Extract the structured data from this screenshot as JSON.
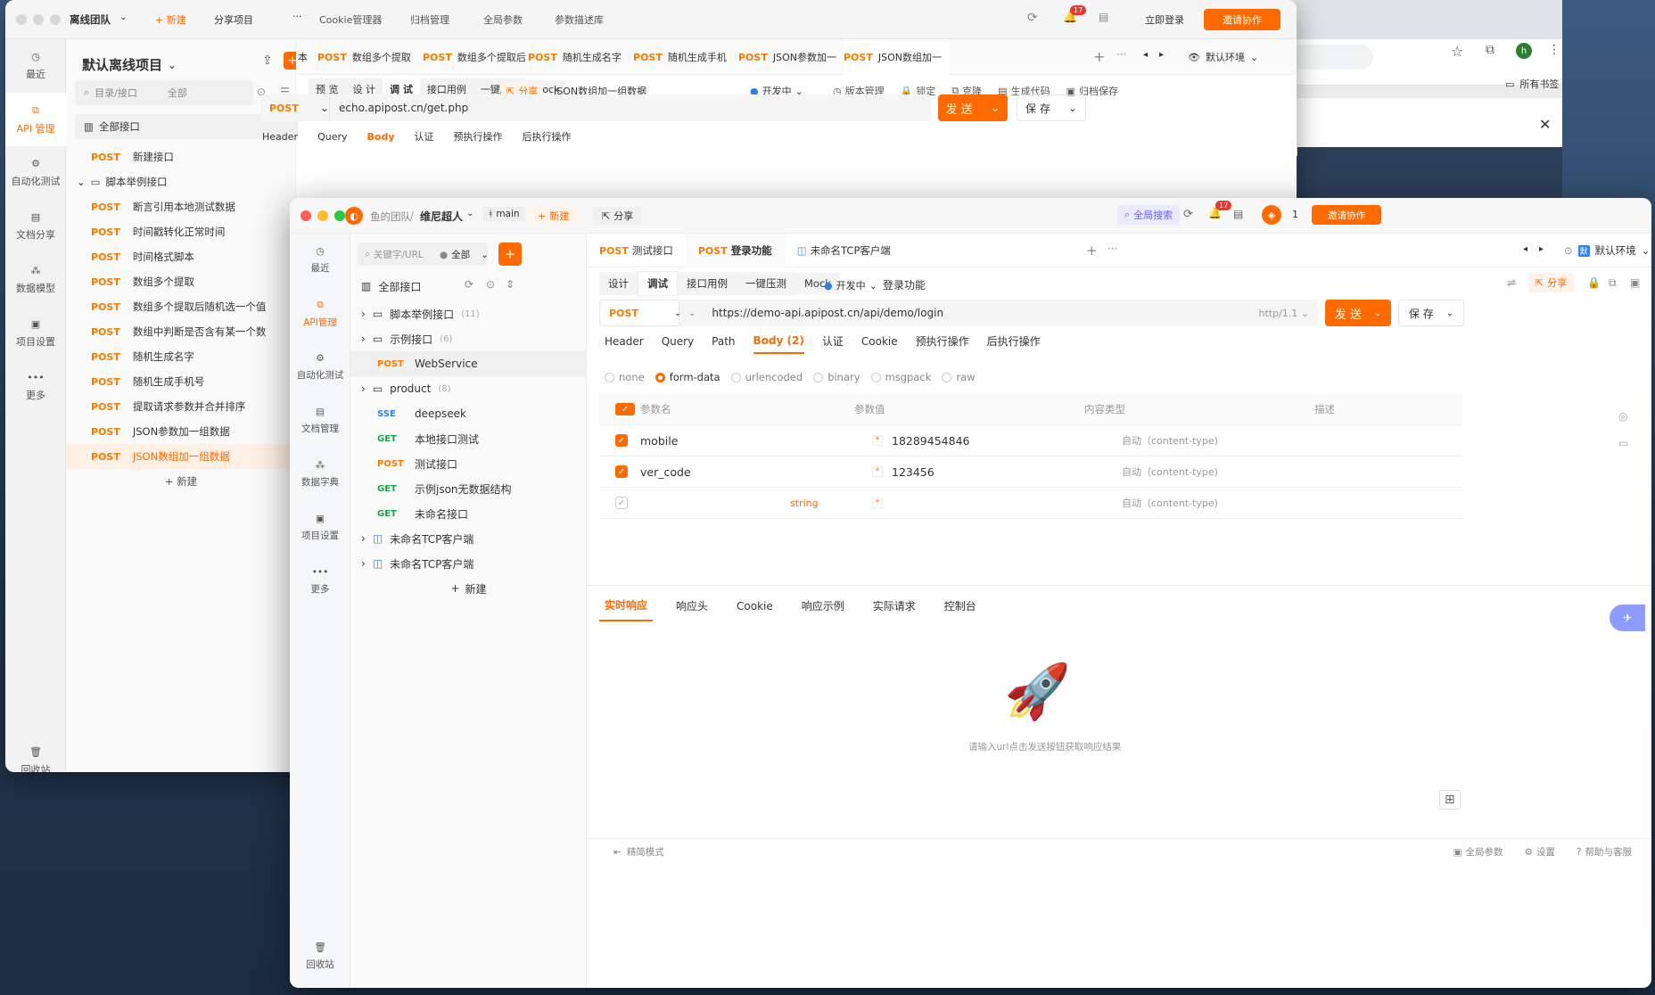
{
  "back": {
    "team": "离线团队",
    "top": [
      "+ 新建",
      "分享项目",
      "···",
      "Cookie管理器",
      "归档管理",
      "全局参数",
      "参数描述库"
    ],
    "badge": "17",
    "login": "立即登录",
    "invite": "邀请协作",
    "sidebar": [
      "最近",
      "API 管理",
      "自动化测试",
      "文档分享",
      "数据模型",
      "项目设置",
      "更多",
      "回收站"
    ],
    "project": "默认离线项目",
    "search_placeholder": "目录/接口",
    "filter_all": "全部",
    "all_apis": "全部接口",
    "folder": "脚本举例接口",
    "new_api_method": "POST",
    "new_api": "新建接口",
    "items": [
      {
        "m": "POST",
        "n": "断言引用本地测试数据"
      },
      {
        "m": "POST",
        "n": "时间戳转化正常时间"
      },
      {
        "m": "POST",
        "n": "时间格式脚本"
      },
      {
        "m": "POST",
        "n": "数组多个提取"
      },
      {
        "m": "POST",
        "n": "数组多个提取后随机选一个值"
      },
      {
        "m": "POST",
        "n": "数组中判断是否含有某一个数"
      },
      {
        "m": "POST",
        "n": "随机生成名字"
      },
      {
        "m": "POST",
        "n": "随机生成手机号"
      },
      {
        "m": "POST",
        "n": "提取请求参数并合并排序"
      },
      {
        "m": "POST",
        "n": "JSON参数加一组数据"
      },
      {
        "m": "POST",
        "n": "JSON数组加一组数据"
      }
    ],
    "add_new": "+ 新建",
    "tabs": [
      {
        "m": "POST",
        "n": "数组多个提取"
      },
      {
        "m": "POST",
        "n": "数组多个提取后"
      },
      {
        "m": "POST",
        "n": "随机生成名字"
      },
      {
        "m": "POST",
        "n": "随机生成手机"
      },
      {
        "m": "POST",
        "n": "JSON参数加一"
      },
      {
        "m": "POST",
        "n": "JSON数组加一"
      }
    ],
    "env": "默认环境",
    "subtabs": [
      "预 览",
      "设 计",
      "调 试",
      "接口用例",
      "一键压测",
      "Mock"
    ],
    "share": "分享",
    "api_name": "JSON数组加一组数据",
    "status": "开发中",
    "tools": [
      "版本管理",
      "锁定",
      "克隆",
      "生成代码",
      "归档保存"
    ],
    "method": "POST",
    "url": "echo.apipost.cn/get.php",
    "send": "发 送",
    "save": "保 存",
    "reqtabs": [
      "Header",
      "Query",
      "Body",
      "认证",
      "预执行操作",
      "后执行操作"
    ],
    "prefix": "本"
  },
  "chrome": {
    "bookmarks": "所有书签",
    "avatar": "h"
  },
  "front": {
    "team": "鱼的团队",
    "project": "维尼超人",
    "branch": "main",
    "new": "新建",
    "share": "分享",
    "global_search": "全局搜索",
    "badge": "17",
    "count": "1",
    "invite": "邀请协作",
    "sidebar": [
      "最近",
      "API管理",
      "自动化测试",
      "文档管理",
      "数据字典",
      "项目设置",
      "更多",
      "回收站"
    ],
    "search_placeholder": "关键字/URL",
    "filter_all": "全部",
    "all_apis": "全部接口",
    "tree": [
      {
        "type": "folder",
        "n": "脚本举例接口",
        "c": "(11)"
      },
      {
        "type": "folder",
        "n": "示例接口",
        "c": "(6)"
      },
      {
        "type": "api",
        "m": "POST",
        "n": "WebService"
      },
      {
        "type": "folder",
        "n": "product",
        "c": "(8)"
      },
      {
        "type": "api",
        "m": "SSE",
        "n": "deepseek"
      },
      {
        "type": "api",
        "m": "GET",
        "n": "本地接口测试"
      },
      {
        "type": "api",
        "m": "POST",
        "n": "测试接口"
      },
      {
        "type": "api",
        "m": "GET",
        "n": "示例json无数据结构"
      },
      {
        "type": "api",
        "m": "GET",
        "n": "未命名接口"
      },
      {
        "type": "tcp",
        "n": "未命名TCP客户端"
      },
      {
        "type": "tcp",
        "n": "未命名TCP客户端"
      }
    ],
    "add_new": "新建",
    "tabs": [
      {
        "m": "POST",
        "n": "测试接口"
      },
      {
        "m": "POST",
        "n": "登录功能"
      },
      {
        "m": "",
        "n": "未命名TCP客户端"
      }
    ],
    "env": "默认环境",
    "subtabs": [
      "设计",
      "调试",
      "接口用例",
      "一键压测",
      "Mock"
    ],
    "status": "开发中",
    "api_name": "登录功能",
    "share_btn": "分享",
    "method": "POST",
    "url": "https://demo-api.apipost.cn/api/demo/login",
    "http": "http/1.1",
    "send": "发 送",
    "save": "保 存",
    "reqtabs": [
      "Header",
      "Query",
      "Path",
      "Body (2)",
      "认证",
      "Cookie",
      "预执行操作",
      "后执行操作"
    ],
    "body_types": [
      "none",
      "form-data",
      "urlencoded",
      "binary",
      "msgpack",
      "raw"
    ],
    "table_headers": [
      "参数名",
      "参数值",
      "内容类型",
      "描述"
    ],
    "rows": [
      {
        "name": "mobile",
        "value": "18289454846",
        "ctype": "自动（content-type)"
      },
      {
        "name": "ver_code",
        "value": "123456",
        "ctype": "自动（content-type)"
      },
      {
        "name": "",
        "value": "",
        "ctype": "自动（content-type)",
        "type": "string"
      }
    ],
    "resp_tabs": [
      "实时响应",
      "响应头",
      "Cookie",
      "响应示例",
      "实际请求",
      "控制台"
    ],
    "empty_hint": "请输入url点击发送按钮获取响应结果",
    "footer": {
      "mode": "精简模式",
      "global_params": "全局参数",
      "settings": "设置",
      "help": "帮助与客服"
    }
  }
}
